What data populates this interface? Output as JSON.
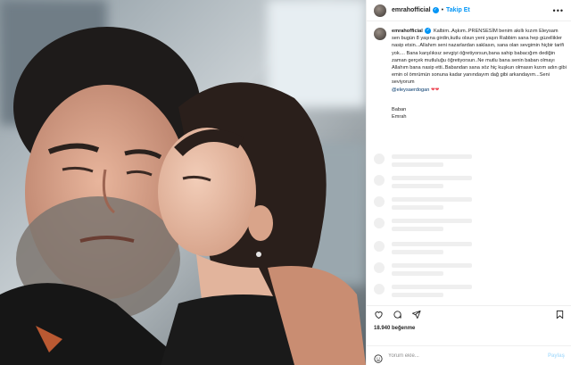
{
  "header": {
    "username": "emrahofficial",
    "separator": "•",
    "follow_label": "Takip Et",
    "more_label": "•••"
  },
  "caption": {
    "username": "emrahofficial",
    "text": "Kalbim..Aşkım..PRENSESİM benim akıllı kızım Eleysam sen bugün 8 yaşına girdin,kutlu olsun yeni yaşın Rabbim sana hep güzellikler nasip etsin...Allahım seni nazarlardan saklasın, sana olan sevgimin hiçbir tarifi yok.... Bana karşılıksız sevgiyi öğretiyorsun,bana sahip babacığım dediğin zaman gerçek mutluluğu öğretiyorsun..Ne mutlu bana senin baban olmayı Allahım bana nasip etti..Babandan sana söz hiç kuşkun olmasın kızım adın gibi emin ol ömrümün sonuna kadar yanındayım dağ gibi arkandayım...Seni seviyorum",
    "mention": "@eleysaerdogan",
    "hearts": "❤❤",
    "sign": "Baban\nEmrah"
  },
  "actions": {
    "like_icon": "heart-icon",
    "comment_icon": "comment-icon",
    "share_icon": "share-icon",
    "save_icon": "bookmark-icon"
  },
  "likes_text": "18.940 beğenme",
  "comment_box": {
    "placeholder": "Yorum ekle...",
    "post_label": "Paylaş"
  },
  "colors": {
    "accent": "#0095f6",
    "mention": "#00376b",
    "heart": "#ed4956",
    "skeleton": "#efefef"
  }
}
